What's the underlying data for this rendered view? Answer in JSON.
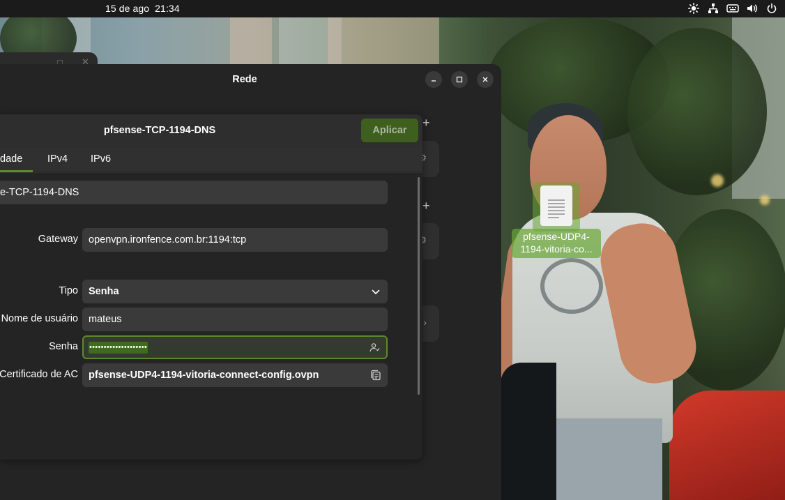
{
  "topbar": {
    "date": "15 de ago",
    "time": "21:34",
    "tray_icons": [
      "brightness-icon",
      "network-icon",
      "keyboard-icon",
      "volume-icon",
      "power-icon"
    ]
  },
  "desktop": {
    "file_icon": {
      "label": "pfsense-UDP4-1194-vitoria-co...",
      "icon": "document-icon"
    }
  },
  "window": {
    "title": "Rede"
  },
  "dialog": {
    "title": "pfsense-TCP-1194-DNS",
    "apply_label": "Aplicar",
    "tabs": [
      {
        "label": "dade",
        "active": true
      },
      {
        "label": "IPv4",
        "active": false
      },
      {
        "label": "IPv6",
        "active": false
      }
    ],
    "fields": {
      "name": {
        "value": "e-TCP-1194-DNS"
      },
      "gateway": {
        "label": "Gateway",
        "value": "openvpn.ironfence.com.br:1194:tcp"
      },
      "type": {
        "label": "Tipo",
        "value": "Senha"
      },
      "username": {
        "label": "Nome de usuário",
        "value": "mateus"
      },
      "password": {
        "label": "Senha",
        "value": "••••••••••••••••••••"
      },
      "ca_cert": {
        "label": "Certificado de AC",
        "value": "pfsense-UDP4-1194-vitoria-connect-config.ovpn"
      }
    }
  },
  "colors": {
    "accent": "#5a8a2a",
    "apply_bg": "#3f5f1f",
    "topbar_bg": "#1b1b1b",
    "window_bg": "#242424"
  }
}
